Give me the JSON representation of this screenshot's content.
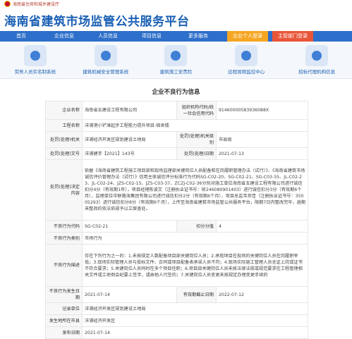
{
  "ministry": "海南省住房和城乡建设厅",
  "site_title": "海南省建筑市场监管公共服务平台",
  "nav": [
    "首页",
    "企业信息",
    "人员信息",
    "项目信息",
    "更多服务",
    "企业个人登录",
    "主管部门登录"
  ],
  "quick_links": [
    {
      "icon": "worker-icon",
      "label": "劳务人员实名制系统"
    },
    {
      "icon": "machinery-icon",
      "label": "建筑机械安全管理系统"
    },
    {
      "icon": "safety-helmet-icon",
      "label": "建筑施工安责险"
    },
    {
      "icon": "video-monitor-icon",
      "label": "远程视频监控中心"
    },
    {
      "icon": "bid-agency-icon",
      "label": "招标代理机构信息"
    }
  ],
  "section_title": "企业不良行为信息",
  "record": {
    "enterprise_name_label": "企业名称",
    "enterprise_name": "海南省五建设工程有限公司",
    "org_code_label": "组织机构代码/统一社会信用代码",
    "org_code": "91460000583936088X",
    "project_name_label": "工程名称",
    "project_name": "洋浦港小铲滩起步工程能力提升项目-宿舍楼",
    "penalty_org_label": "处罚(处理)机关",
    "penalty_org": "洋浦经济开发区规划建设土地局",
    "penalty_level_label": "处罚(处理)机关级别",
    "penalty_level": "市县级",
    "doc_no_label": "处罚(处理)文号",
    "doc_no": "洋浦建字【2021】143号",
    "penalty_date_label": "处罚(处理)日期",
    "penalty_date": "2021-07-13",
    "decision_label": "处罚(处理)决定内容",
    "decision": "依据《海南省建筑工程施工项目部和现场监理部关键岗位人员配备和在岗履职管理办法（试行）》、《海南省建筑市场诚信评价管理办法（试行）》信用主体诚信评分标准行为代码SG-C02-20、SG-C02-21、SG-C03-55、JL-C02-23、JL-C02-24、JZS-C02-15、JZS-C03-37、ZCZJ-C02-36分别对施工单位海南省五建设工程有限公司进行诚信扣分4分（有效期1年），项目经理陈波文（注册执业证书号：琼246080901403）进行诚信扣分3分（有效期6个月），监理单位中联路海集团有限公司进行诚信扣分2分（有效期6个月），项目总监韦世佳（注册执业证书号：35005293）进行诚信扣分8分（有效期6个月），上传至海南省建筑市场监管公共服务平台，限期7日内整改完毕，逾期未整改的依法依规予以立案查处。",
    "behavior_code_label": "不良行为代码",
    "behavior_code": "SG-C02-21",
    "deduct_label": "扣分分值",
    "deduct": "4",
    "category_label": "不良行为类别",
    "category": "市场行为",
    "description_label": "不良行为描述",
    "description": "存在下列行为之一的：1.未按规定人数配备项目部关键岗位人员；2.承揽项目在现场的关键岗位人员在岗履职率低；3.现场实际管理人员与投标文件、合同或项目配备表承诺人员不符；4.现场实际施工管理人员无证上岗或证书不符合要求；5.关键岗位人员同时在多个项目任职；6.项目部关键岗位人员未按法律法规或规范要求在工程管理相关文件或工地例会纪要上签字，或由他人代签的；7.关键岗位人员变更未按规定办理变更手续的",
    "occur_date_label": "不良行为发生日期",
    "occur_date": "2021-07-14",
    "valid_until_label": "有效期截止日期",
    "valid_until": "2022-07-12",
    "record_org_label": "记录单位",
    "record_org": "洋浦经济开发区规划建设土地局",
    "location_label": "发生地所在市县",
    "location": "洋浦经济开发区",
    "publish_date_label": "发布日期",
    "publish_date": "2021-07-14"
  }
}
